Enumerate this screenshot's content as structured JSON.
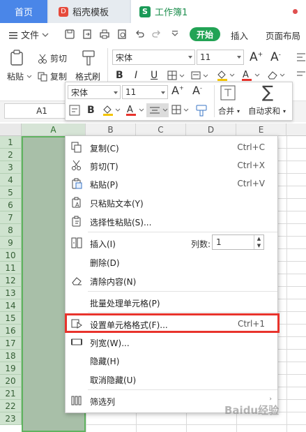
{
  "tabs": {
    "home": "首页",
    "templates": "稻壳模板",
    "templates_icon": "D",
    "workbook": "工作簿1",
    "workbook_icon": "S"
  },
  "menubar": {
    "file": "文件",
    "start": "开始",
    "insert": "插入",
    "layout": "页面布局"
  },
  "ribbon": {
    "cut": "剪切",
    "paste": "粘贴",
    "copy": "复制",
    "format_painter": "格式刷",
    "font": "宋体",
    "size": "11",
    "bold": "B",
    "italic": "I",
    "underline": "U"
  },
  "namebox": "A1",
  "columns": [
    "A",
    "B",
    "C",
    "D",
    "E"
  ],
  "rows": [
    "1",
    "2",
    "3",
    "4",
    "5",
    "6",
    "7",
    "8",
    "9",
    "10",
    "11",
    "12",
    "13",
    "14",
    "15",
    "16",
    "17",
    "18",
    "19",
    "20",
    "21",
    "22",
    "23"
  ],
  "mini_toolbar": {
    "font": "宋体",
    "size": "11",
    "bold": "B",
    "merge": "合并",
    "autosum": "自动求和",
    "sum_symbol": "∑"
  },
  "context_menu": {
    "copy": "复制(C)",
    "copy_sc": "Ctrl+C",
    "cut": "剪切(T)",
    "cut_sc": "Ctrl+X",
    "paste": "粘贴(P)",
    "paste_sc": "Ctrl+V",
    "paste_text": "只粘贴文本(Y)",
    "paste_special": "选择性粘贴(S)...",
    "insert": "插入(I)",
    "col_count_label": "列数:",
    "col_count_value": "1",
    "delete": "删除(D)",
    "clear": "清除内容(N)",
    "batch": "批量处理单元格(P)",
    "format_cells": "设置单元格格式(F)...",
    "format_cells_sc": "Ctrl+1",
    "col_width": "列宽(W)...",
    "hide": "隐藏(H)",
    "unhide": "取消隐藏(U)",
    "filter_col": "筛选列"
  },
  "colors": {
    "accent_green": "#22a355",
    "highlight_red": "#e8332c",
    "selected_col": "#a8bfa8"
  },
  "watermark": "Baidu经验"
}
